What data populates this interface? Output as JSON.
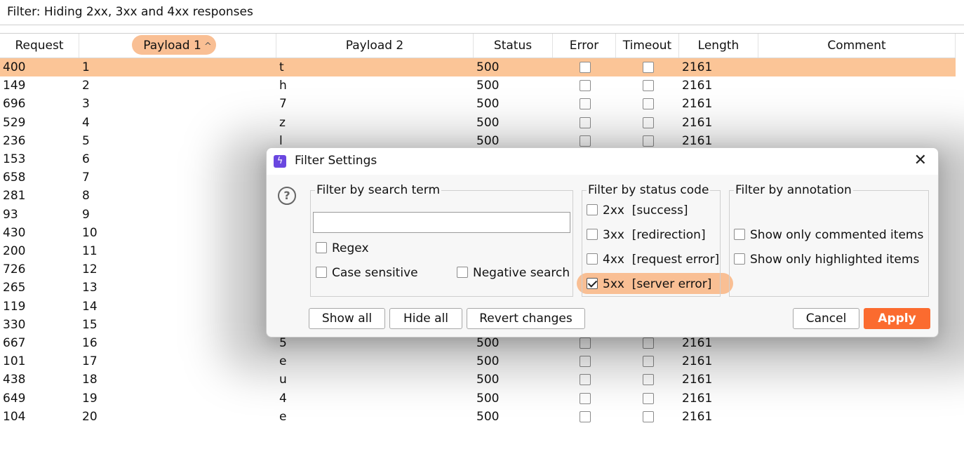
{
  "filter_bar": {
    "text": "Filter: Hiding 2xx, 3xx and 4xx responses"
  },
  "table": {
    "columns": [
      "Request",
      "Payload 1",
      "Payload 2",
      "Status",
      "Error",
      "Timeout",
      "Length",
      "Comment"
    ],
    "sorted_column": "Payload 1",
    "sort_icon": "caret-up-icon",
    "selected_row_index": 0,
    "rows": [
      {
        "request": "400",
        "payload1": "1",
        "payload2": "t",
        "status": "500",
        "length": "2161"
      },
      {
        "request": "149",
        "payload1": "2",
        "payload2": "h",
        "status": "500",
        "length": "2161"
      },
      {
        "request": "696",
        "payload1": "3",
        "payload2": "7",
        "status": "500",
        "length": "2161"
      },
      {
        "request": "529",
        "payload1": "4",
        "payload2": "z",
        "status": "500",
        "length": "2161"
      },
      {
        "request": "236",
        "payload1": "5",
        "payload2": "l",
        "status": "500",
        "length": "2161"
      },
      {
        "request": "153",
        "payload1": "6",
        "payload2": "",
        "status": "",
        "length": ""
      },
      {
        "request": "658",
        "payload1": "7",
        "payload2": "",
        "status": "",
        "length": ""
      },
      {
        "request": "281",
        "payload1": "8",
        "payload2": "",
        "status": "",
        "length": ""
      },
      {
        "request": "93",
        "payload1": "9",
        "payload2": "",
        "status": "",
        "length": ""
      },
      {
        "request": "430",
        "payload1": "10",
        "payload2": "",
        "status": "",
        "length": ""
      },
      {
        "request": "200",
        "payload1": "11",
        "payload2": "",
        "status": "",
        "length": ""
      },
      {
        "request": "726",
        "payload1": "12",
        "payload2": "",
        "status": "",
        "length": ""
      },
      {
        "request": "265",
        "payload1": "13",
        "payload2": "",
        "status": "",
        "length": ""
      },
      {
        "request": "119",
        "payload1": "14",
        "payload2": "",
        "status": "",
        "length": ""
      },
      {
        "request": "330",
        "payload1": "15",
        "payload2": "",
        "status": "",
        "length": ""
      },
      {
        "request": "667",
        "payload1": "16",
        "payload2": "5",
        "status": "500",
        "length": "2161"
      },
      {
        "request": "101",
        "payload1": "17",
        "payload2": "e",
        "status": "500",
        "length": "2161"
      },
      {
        "request": "438",
        "payload1": "18",
        "payload2": "u",
        "status": "500",
        "length": "2161"
      },
      {
        "request": "649",
        "payload1": "19",
        "payload2": "4",
        "status": "500",
        "length": "2161"
      },
      {
        "request": "104",
        "payload1": "20",
        "payload2": "e",
        "status": "500",
        "length": "2161"
      }
    ]
  },
  "dialog": {
    "title": "Filter Settings",
    "title_icon": "burp-lightning-icon",
    "close_glyph": "✕",
    "help_glyph": "?",
    "search_group": {
      "legend": "Filter by search term",
      "search_value": "",
      "regex_label": "Regex",
      "regex_checked": false,
      "case_label": "Case sensitive",
      "case_checked": false,
      "negative_label": "Negative search",
      "negative_checked": false
    },
    "status_group": {
      "legend": "Filter by status code",
      "options": [
        {
          "label": "2xx  [success]",
          "checked": false
        },
        {
          "label": "3xx  [redirection]",
          "checked": false
        },
        {
          "label": "4xx  [request error]",
          "checked": false
        },
        {
          "label": "5xx  [server error]",
          "checked": true
        }
      ]
    },
    "annotation_group": {
      "legend": "Filter by annotation",
      "options": [
        {
          "label": "Show only commented items",
          "checked": false
        },
        {
          "label": "Show only highlighted items",
          "checked": false
        }
      ]
    },
    "buttons": {
      "show_all": "Show all",
      "hide_all": "Hide all",
      "revert": "Revert changes",
      "cancel": "Cancel",
      "apply": "Apply"
    }
  },
  "colors": {
    "highlight": "#fbc597",
    "apply_button": "#fb6b2f",
    "burp_icon": "#6a47e0"
  }
}
